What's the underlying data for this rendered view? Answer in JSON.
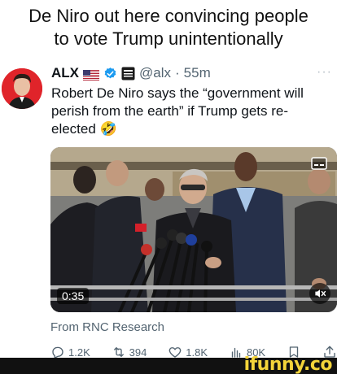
{
  "caption": {
    "line1": "De Niro out here convincing people",
    "line2": "to vote Trump unintentionally"
  },
  "tweet": {
    "author_name": "ALX",
    "handle": "@alx",
    "separator": "·",
    "time": "55m",
    "more": "···",
    "text": "Robert De Niro says the “government will perish from the earth” if Trump gets re-elected",
    "emoji": "🤣",
    "media": {
      "duration": "0:35",
      "mute_icon": "mute-icon",
      "cc_icon": "cc-icon"
    },
    "source": "From RNC Research",
    "actions": {
      "replies": "1.2K",
      "reposts": "394",
      "likes": "1.8K",
      "views": "80K"
    }
  },
  "watermark": {
    "text": "ifunny.co"
  },
  "colors": {
    "verified_blue": "#1d9bf0",
    "muted_text": "#536471",
    "ifunny_yellow": "#f3d43a",
    "avatar_red": "#e0242a"
  }
}
